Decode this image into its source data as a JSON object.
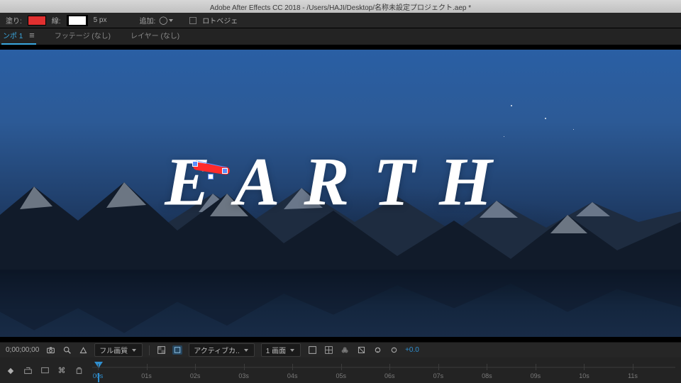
{
  "app": {
    "title": "Adobe After Effects CC 2018 - /Users/HAJI/Desktop/名称未設定プロジェクト.aep *"
  },
  "toolbar": {
    "fill_label": "塗り:",
    "fill_color": "#e03030",
    "stroke_label": "線:",
    "stroke_color": "#ffffff",
    "stroke_width": "5 px",
    "add_label": "追加:",
    "rotobezier_label": "ロトベジェ"
  },
  "panel_tabs": {
    "active": "ンポ 1",
    "footage": "フッテージ (なし)",
    "layer": "レイヤー (なし)"
  },
  "composition": {
    "title_text": "EARTH"
  },
  "viewer_footer": {
    "timecode": "0;00;00;00",
    "quality_label": "フル画質",
    "camera_label": "アクティブカ..",
    "view_count": "1 画面",
    "exposure": "+0.0"
  },
  "timeline": {
    "ticks": [
      "00s",
      "01s",
      "02s",
      "03s",
      "04s",
      "05s",
      "06s",
      "07s",
      "08s",
      "09s",
      "10s",
      "11s"
    ],
    "playhead_at": 0
  }
}
